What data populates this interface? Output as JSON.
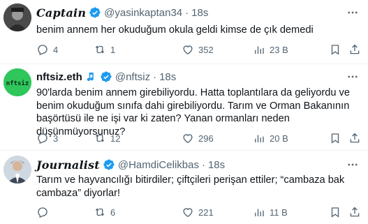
{
  "tweets": [
    {
      "name": "Captain",
      "handle": "@yasinkaptan34",
      "dot": "·",
      "time": "18s",
      "text": "benim annem her okuduğum okula geldi kimse de çık demedi",
      "replies": "4",
      "retweets": "1",
      "likes": "352",
      "views": "23 B"
    },
    {
      "name": "nftsiz.eth",
      "name_emoji": "🎶",
      "handle": "@nftsiz",
      "dot": "·",
      "time": "18s",
      "avatar_text": "nftsiz",
      "text": "90'larda benim annem girebiliyordu. Hatta toplantılara da geliyordu ve benim okuduğum sınıfa dahi girebiliyordu. Tarım ve Orman Bakanının başörtüsü ile ne işi var ki zaten? Yanan ormanları neden düşünmüyorsunuz?",
      "replies": "3",
      "retweets": "12",
      "likes": "296",
      "views": "20 B"
    },
    {
      "name": "Journalist",
      "handle": "@HamdiCelikbas",
      "dot": "·",
      "time": "18s",
      "text": "Tarım ve hayvancılığı bitirdiler; çiftçileri perişan ettiler; “cambaza bak cambaza” diyorlar!",
      "replies": "",
      "retweets": "6",
      "likes": "221",
      "views": "11 B"
    }
  ],
  "colors": {
    "text": "#0f1419",
    "secondary": "#536471",
    "verified": "#1d9bf0",
    "divider": "#eff3f4",
    "nft_avatar_bg": "#22c55e"
  },
  "icons": [
    "verified-badge-icon",
    "more-icon",
    "reply-icon",
    "retweet-icon",
    "like-icon",
    "views-icon",
    "bookmark-icon",
    "share-icon",
    "music-note-icon"
  ]
}
